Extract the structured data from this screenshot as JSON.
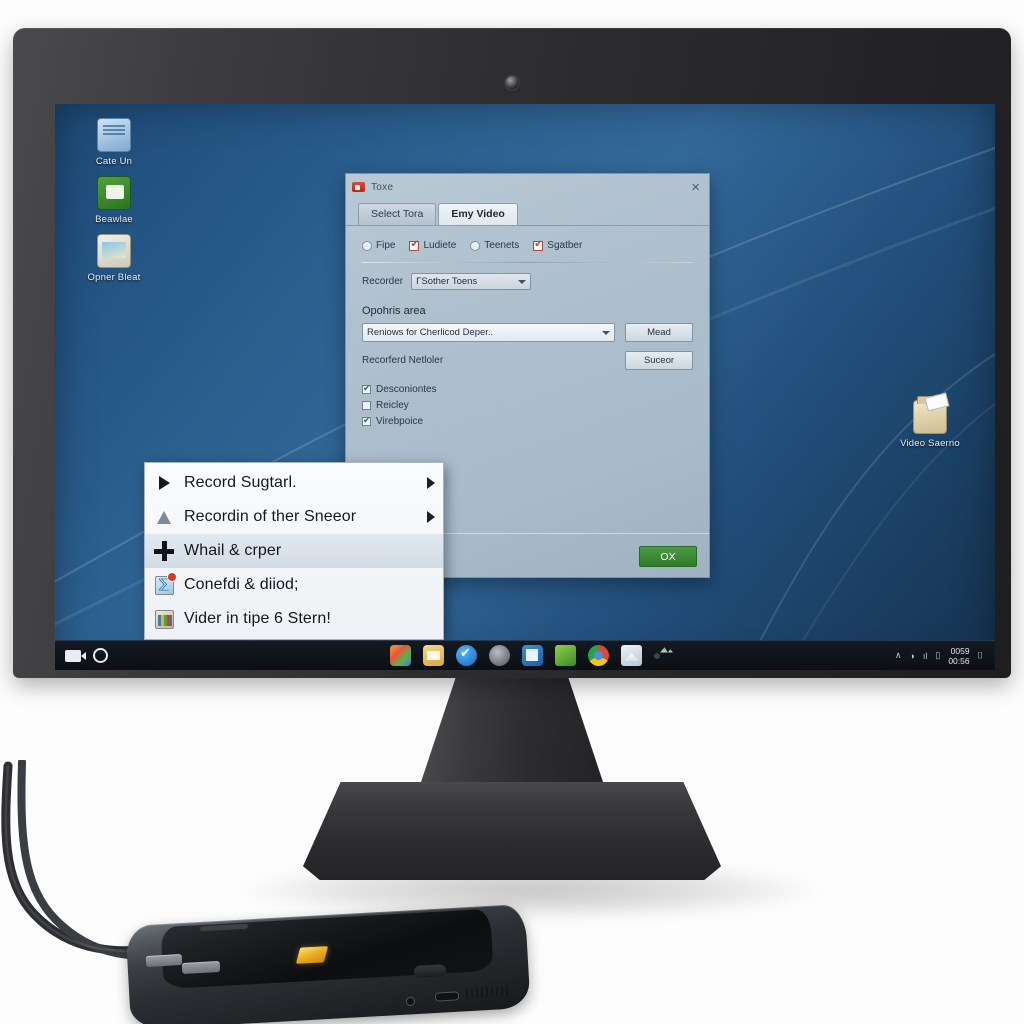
{
  "scene": {
    "description": "All-in-one desktop monitor showing a Windows desktop with a screen-recorder dialog and an open context menu; a smartphone connected by a USB cable rests in front."
  },
  "monitor": {
    "webcam_label": "webcam",
    "brand_logo": "swirl-logo"
  },
  "desktop": {
    "wallpaper_colors": [
      "#1d4a78",
      "#33699a",
      "#15324f"
    ],
    "icons": [
      {
        "name": "document-icon",
        "label": "Cate Un",
        "style": "doc"
      },
      {
        "name": "green-app-icon",
        "label": "Beawlae",
        "style": "green"
      },
      {
        "name": "picture-viewer-icon",
        "label": "Opner Bleat",
        "style": "pic"
      },
      {
        "name": "video-folder-icon",
        "label": "Video Saerno",
        "style": "folder"
      }
    ]
  },
  "dialog": {
    "title": "Toxe",
    "close_label": "×",
    "tabs": [
      {
        "label": "Select Tora",
        "active": false
      },
      {
        "label": "Emy Video",
        "active": true
      }
    ],
    "options_row": [
      {
        "label": "Fipe",
        "type": "radio",
        "checked": false
      },
      {
        "label": "Ludiete",
        "type": "checkbox",
        "checked": true
      },
      {
        "label": "Teenets",
        "type": "radio",
        "checked": false
      },
      {
        "label": "Sgatber",
        "type": "checkbox",
        "checked": true
      }
    ],
    "recorder_label": "Recorder",
    "recorder_value": "ΓSother Toens",
    "section_label": "Opohris area",
    "area_value": "Reniows for Cherlicod Deper..",
    "area_button": "Mead",
    "sub_label": "Recorferd Netloler",
    "sub_button": "Suceor",
    "checklist": [
      {
        "label": "Desconiontes",
        "checked": true
      },
      {
        "label": "Reicley",
        "checked": false
      },
      {
        "label": "Virebpoice",
        "checked": true
      }
    ],
    "ok_button": "OX"
  },
  "context_menu": {
    "items": [
      {
        "label": "Record Sugtarl.",
        "icon": "play-triangle-icon",
        "submenu": true,
        "highlighted": false
      },
      {
        "label": "Recordin of ther Sneeor",
        "icon": "cone-icon",
        "submenu": true,
        "highlighted": false
      },
      {
        "label": "Whail & crper",
        "icon": "plus-icon",
        "submenu": false,
        "highlighted": true
      },
      {
        "label": "Conefdi & diiod;",
        "icon": "blue-app-icon",
        "submenu": false,
        "highlighted": false
      },
      {
        "label": "Vider in tipe 6 Stern!",
        "icon": "multicolor-app-icon",
        "submenu": false,
        "highlighted": false
      }
    ]
  },
  "taskbar": {
    "left_icons": [
      {
        "name": "camera-record-icon"
      },
      {
        "name": "cortana-circle-icon"
      }
    ],
    "apps": [
      {
        "name": "store-icon",
        "running": false
      },
      {
        "name": "file-explorer-icon",
        "running": true
      },
      {
        "name": "edge-icon",
        "running": true
      },
      {
        "name": "dark-app-icon",
        "running": false
      },
      {
        "name": "office-icon",
        "running": true
      },
      {
        "name": "recycle-app-icon",
        "running": false
      },
      {
        "name": "chrome-icon",
        "running": true
      },
      {
        "name": "mail-icon",
        "running": true
      },
      {
        "name": "photo-app-icon",
        "running": false,
        "selected": true
      }
    ],
    "tray": {
      "chevron": "∧",
      "network_icon": "network-icon",
      "volume_icon": "volume-icon",
      "battery_icon": "battery-icon",
      "clock_line1": "0059",
      "clock_line2": "00:56",
      "notification": "␣"
    }
  },
  "phone": {
    "name": "smartphone",
    "screen_badge": "gold-app-icon"
  },
  "cable": {
    "name": "usb-cable"
  }
}
